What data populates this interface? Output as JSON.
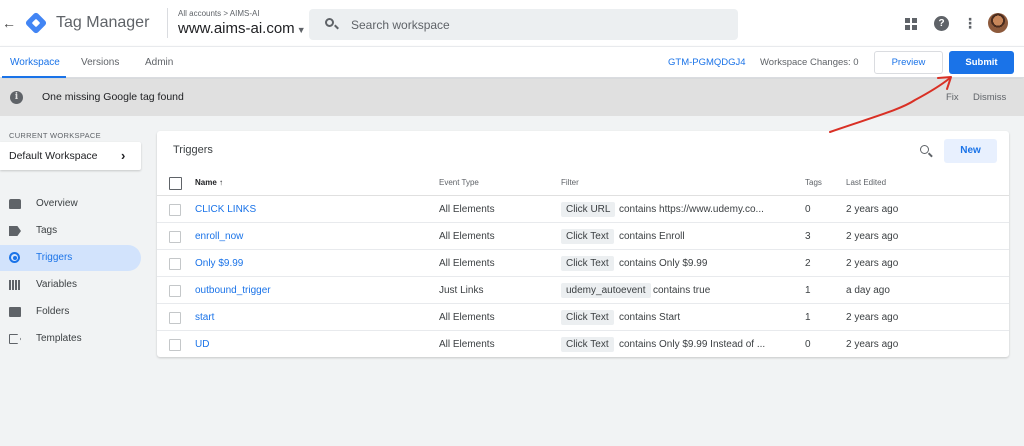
{
  "header": {
    "back_glyph": "←",
    "product_name": "Tag Manager",
    "breadcrumb": "All accounts > AIMS-AI",
    "container_name": "www.aims-ai.com",
    "search_placeholder": "Search workspace"
  },
  "subnav": {
    "tabs": [
      {
        "label": "Workspace",
        "active": true
      },
      {
        "label": "Versions",
        "active": false
      },
      {
        "label": "Admin",
        "active": false
      }
    ],
    "container_id": "GTM-PGMQDGJ4",
    "workspace_changes": "Workspace Changes: 0",
    "preview_label": "Preview",
    "submit_label": "Submit"
  },
  "banner": {
    "message": "One missing Google tag found",
    "fix_label": "Fix",
    "dismiss_label": "Dismiss"
  },
  "sidebar": {
    "current_workspace_label": "CURRENT WORKSPACE",
    "workspace_name": "Default Workspace",
    "items": [
      {
        "label": "Overview",
        "icon": "overview-icon",
        "active": false
      },
      {
        "label": "Tags",
        "icon": "tag-icon",
        "active": false
      },
      {
        "label": "Triggers",
        "icon": "trigger-icon",
        "active": true
      },
      {
        "label": "Variables",
        "icon": "variables-icon",
        "active": false
      },
      {
        "label": "Folders",
        "icon": "folder-icon",
        "active": false
      },
      {
        "label": "Templates",
        "icon": "template-icon",
        "active": false
      }
    ]
  },
  "triggers": {
    "title": "Triggers",
    "new_label": "New",
    "columns": {
      "name": "Name ↑",
      "event_type": "Event Type",
      "filter": "Filter",
      "tags": "Tags",
      "last_edited": "Last Edited"
    },
    "rows": [
      {
        "name": "CLICK LINKS",
        "event_type": "All Elements",
        "filter_var": "Click URL",
        "filter_cond": "contains https://www.udemy.co...",
        "tags": "0",
        "last_edited": "2 years ago"
      },
      {
        "name": "enroll_now",
        "event_type": "All Elements",
        "filter_var": "Click Text",
        "filter_cond": "contains Enroll",
        "tags": "3",
        "last_edited": "2 years ago"
      },
      {
        "name": "Only $9.99",
        "event_type": "All Elements",
        "filter_var": "Click Text",
        "filter_cond": "contains Only $9.99",
        "tags": "2",
        "last_edited": "2 years ago"
      },
      {
        "name": "outbound_trigger",
        "event_type": "Just Links",
        "filter_var": "udemy_autoevent",
        "filter_cond": "contains true",
        "tags": "1",
        "last_edited": "a day ago"
      },
      {
        "name": "start",
        "event_type": "All Elements",
        "filter_var": "Click Text",
        "filter_cond": "contains Start",
        "tags": "1",
        "last_edited": "2 years ago"
      },
      {
        "name": "UD",
        "event_type": "All Elements",
        "filter_var": "Click Text",
        "filter_cond": "contains Only $9.99 Instead of ...",
        "tags": "0",
        "last_edited": "2 years ago"
      }
    ]
  },
  "colors": {
    "accent": "#1a73e8",
    "annotation_arrow": "#d93025"
  }
}
